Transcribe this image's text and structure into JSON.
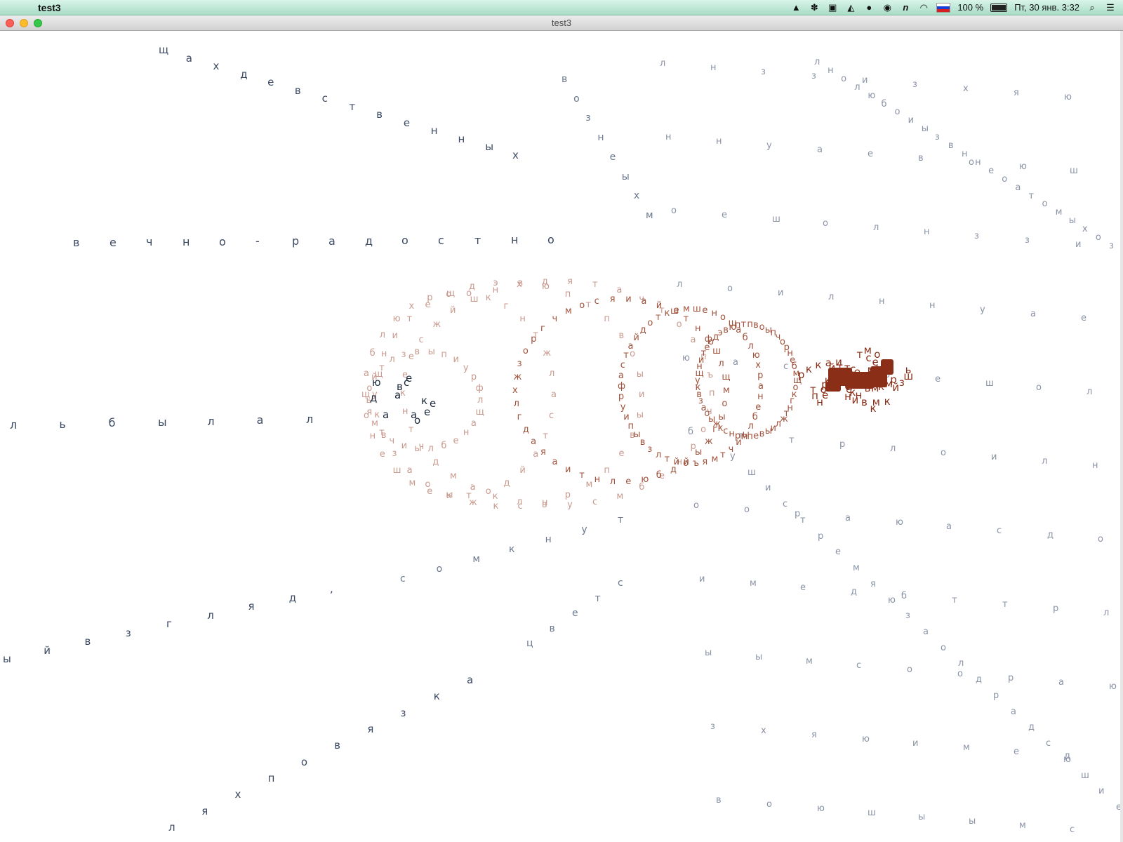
{
  "menubar": {
    "app_name": "test3",
    "battery": "100 %",
    "datetime": "Пт, 30 янв.  3:32",
    "icons": [
      "apple-icon",
      "google-drive-icon",
      "paw-icon",
      "clipboard-icon",
      "bell-icon",
      "alien-icon",
      "car-icon",
      "n-icon",
      "wifi-icon",
      "russian-flag-icon",
      "battery-icon",
      "search-icon",
      "list-icon"
    ]
  },
  "window": {
    "title": "test3"
  },
  "canvas": {
    "phrases": [
      {
        "text": "щахдевственных",
        "color": "#3c4a64"
      },
      {
        "text": "вечно-радостно",
        "color": "#3c4a64"
      },
      {
        "text": "льбылал",
        "color": "#3c4a64"
      },
      {
        "text": "ыйвзгляд,",
        "color": "#3c4a64"
      },
      {
        "text": "сомкнут",
        "color": "#6b7890"
      },
      {
        "text": "вознеыхм",
        "color": "#6b7890"
      },
      {
        "text": "ляхповязка",
        "color": "#3c4a64"
      },
      {
        "text": "цветс",
        "color": "#6b7890"
      },
      {
        "text": "лнолюбоиызвннеоатомыхоз",
        "color": "#8a93a6"
      },
      {
        "text": "ушистремяюзаолдрадсюшие",
        "color": "#8a93a6"
      }
    ],
    "rings_text": "лщанеблы ичтмяъ ойтлзвы пиурфастайдоткемшен ощ а блюхрщо кгн тжлиывепмрнскжыоазвкущнитеодэвю птпв оыпч орне бмсувлкамдчтнкеесжйшнхдятачтоапъмоыг жыйд бюелнтиаяадглхжзоргчмосяиайштнфш",
    "dark_text": "ювеааееадоск",
    "swarm_text": "кревкшнийтоктмосмкьиазпмнйрет",
    "colors": {
      "ring": "#c99a8e",
      "ring_dark": "#a0523b",
      "swarm": "#8a2e17",
      "dark": "#1d2a3c",
      "grey": "#8a93a6"
    }
  }
}
